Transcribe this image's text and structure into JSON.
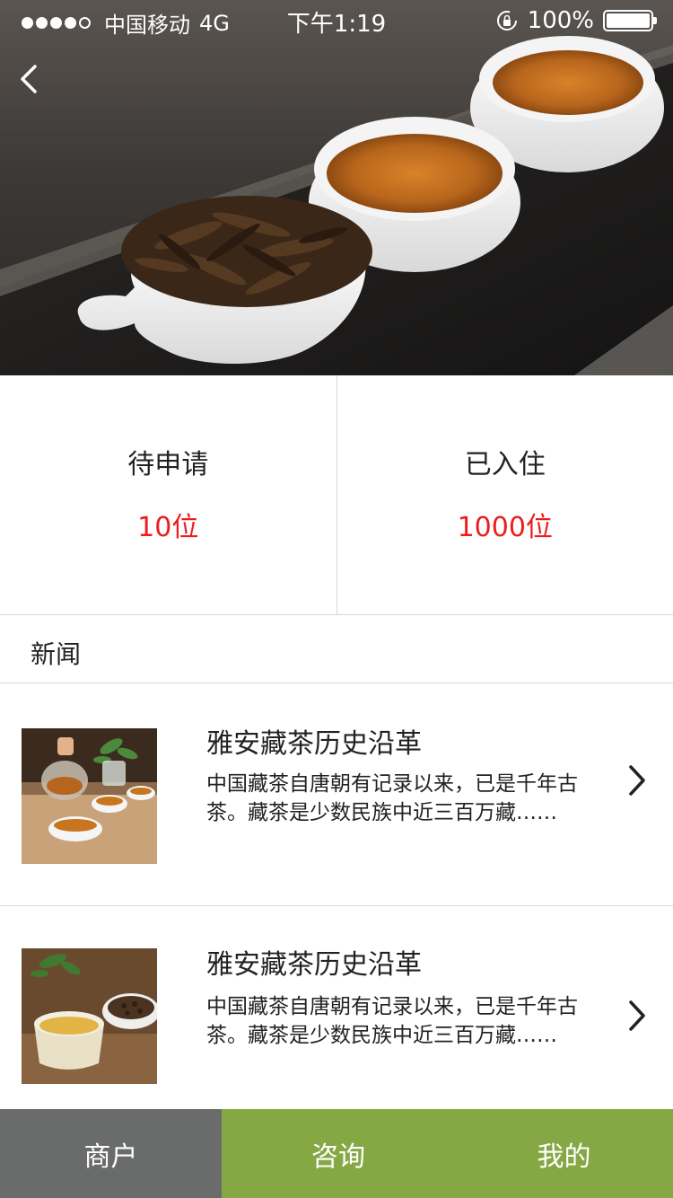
{
  "status_bar": {
    "carrier": "中国移动",
    "network": "4G",
    "time": "下午1:19",
    "battery": "100%"
  },
  "stats": [
    {
      "label": "待申请",
      "value": "10位"
    },
    {
      "label": "已入住",
      "value": "1000位"
    }
  ],
  "news": {
    "title": "新闻",
    "items": [
      {
        "title": "雅安藏茶历史沿革",
        "summary": "中国藏茶自唐朝有记录以来，已是千年古茶。藏茶是少数民族中近三百万藏……"
      },
      {
        "title": "雅安藏茶历史沿革",
        "summary": "中国藏茶自唐朝有记录以来，已是千年古茶。藏茶是少数民族中近三百万藏……"
      }
    ]
  },
  "tabs": {
    "merchant": "商户",
    "consult": "咨询",
    "mine": "我的"
  },
  "colors": {
    "accent_green": "#85a845",
    "tab_gray": "#6a6b6b",
    "highlight_red": "#ee1c1c"
  }
}
